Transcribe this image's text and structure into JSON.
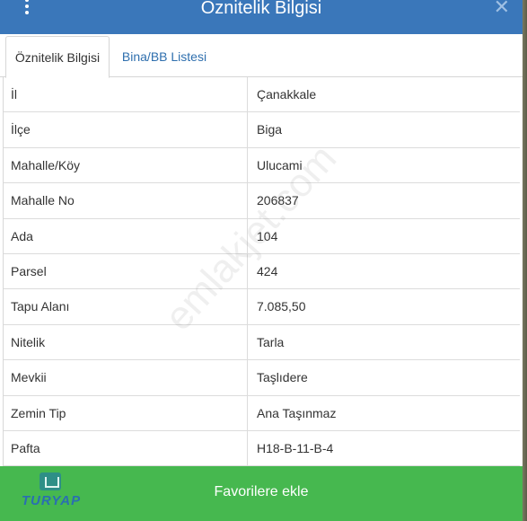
{
  "dialog": {
    "title": "Öznitelik Bilgisi",
    "close_glyph": "✕"
  },
  "tabs": [
    {
      "label": "Öznitelik Bilgisi",
      "active": true
    },
    {
      "label": "Bina/BB Listesi",
      "active": false
    }
  ],
  "attributes": [
    {
      "label": "İl",
      "value": "Çanakkale"
    },
    {
      "label": "İlçe",
      "value": "Biga"
    },
    {
      "label": "Mahalle/Köy",
      "value": "Ulucami"
    },
    {
      "label": "Mahalle No",
      "value": "206837"
    },
    {
      "label": "Ada",
      "value": "104"
    },
    {
      "label": "Parsel",
      "value": "424"
    },
    {
      "label": "Tapu Alanı",
      "value": "7.085,50"
    },
    {
      "label": "Nitelik",
      "value": "Tarla"
    },
    {
      "label": "Mevkii",
      "value": "Taşlıdere"
    },
    {
      "label": "Zemin Tip",
      "value": "Ana Taşınmaz"
    },
    {
      "label": "Pafta",
      "value": "H18-B-11-B-4"
    }
  ],
  "footer": {
    "favorite_label": "Favorilere ekle",
    "logo_text": "TURYAP"
  },
  "watermark": "emlakjet.com",
  "colors": {
    "header": "#3a77ba",
    "footer": "#46b84f",
    "link": "#2f6fae"
  },
  "icons": {
    "menu": "vertical-dots-icon",
    "close": "close-icon",
    "logo": "turyap-logo-icon"
  }
}
